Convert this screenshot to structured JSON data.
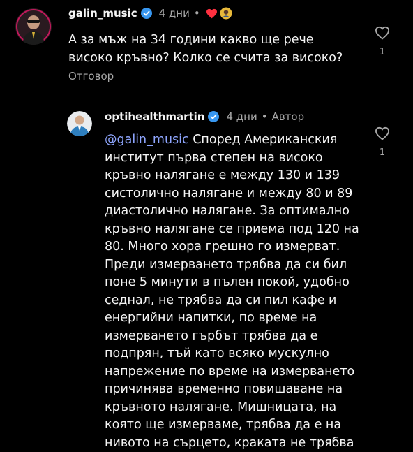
{
  "comments": [
    {
      "username": "galin_music",
      "time": "4 дни",
      "dot": "•",
      "text": "А за мъж на 34 години какво ще рече\nвисоко кръвно? Колко се счита за високо?",
      "reply_label": "Отговор",
      "like_count": "1",
      "icons": [
        "verified-icon",
        "red-heart-icon",
        "avatar-reaction-icon",
        "heart-outline-icon"
      ]
    },
    {
      "username": "optihealthmartin",
      "time": "4 дни",
      "dot": "•",
      "author_label": "Автор",
      "mention": "@galin_music",
      "text": " Според Американския\nинститут първа степен на високо\nкръвно налягане е между 130 и 139\nсистолично налягане и между 80 и 89\nдиастолично налягане. За оптимално\nкръвно налягане се приема под 120 на\n80. Много хора грешно го измерват.\nПреди измерването трябва да си бил\nпоне 5 минути в пълен покой, удобно\nседнал, не трябва да си пил кафе и\nенергийни напитки, по време на\nизмерването гърбът трябва да е\nподпрян, тъй като всяко мускулно\nнапрежение по време на измерването\nпричинява временно повишаване на\nкръвното налягане. Мишницата, на\nкоято ще измерваме, трябва да е на\nнивото на сърцето, краката не трябва",
      "like_count": "1",
      "icons": [
        "verified-icon",
        "heart-outline-icon"
      ]
    }
  ],
  "colors": {
    "background": "#000000",
    "text": "#f5f5f5",
    "muted": "#a8a8a8",
    "mention": "#8fa6ff",
    "verified": "#3897f0"
  }
}
